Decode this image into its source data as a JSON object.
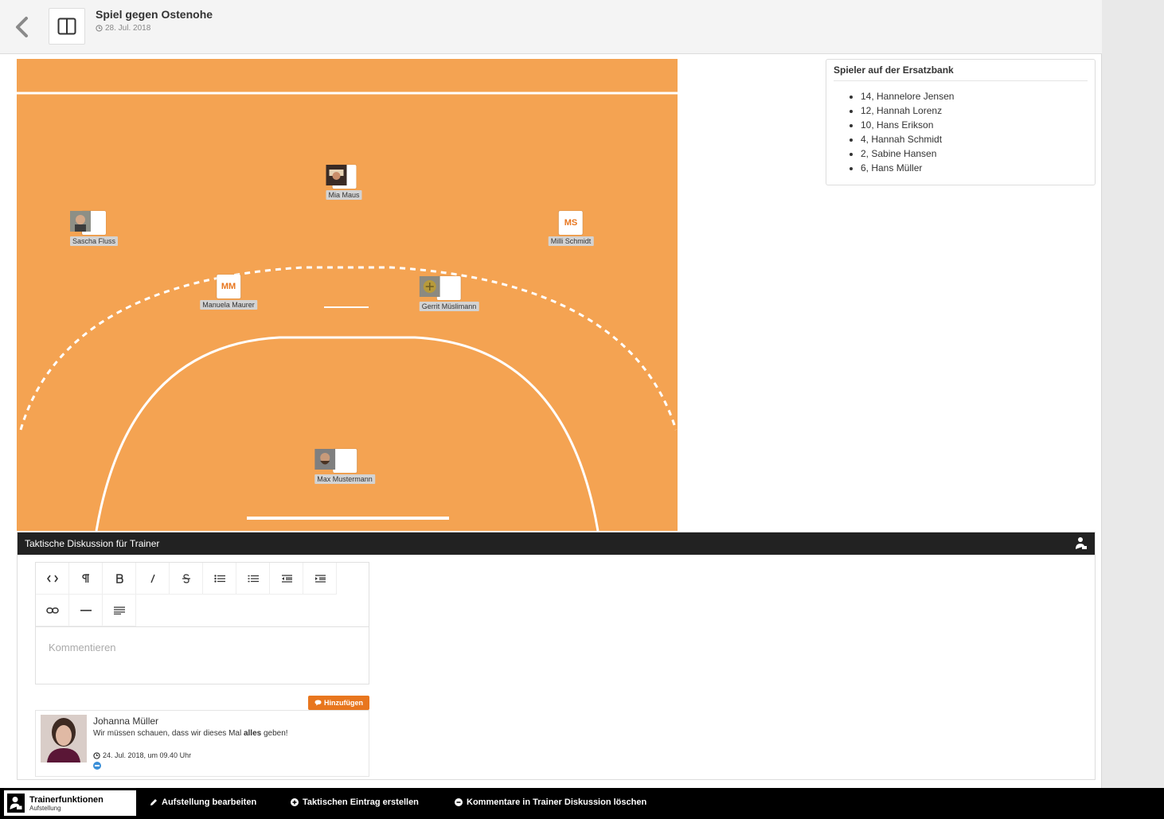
{
  "header": {
    "title": "Spiel gegen Ostenohe",
    "date": "28. Jul. 2018"
  },
  "field": {
    "color": "#f4a352",
    "players": [
      {
        "name": "Mia Maus",
        "initials": "",
        "photo": true
      },
      {
        "name": "Sascha Fluss",
        "initials": "",
        "photo": true
      },
      {
        "name": "Milli Schmidt",
        "initials": "MS",
        "photo": false
      },
      {
        "name": "Manuela Maurer",
        "initials": "MM",
        "photo": false
      },
      {
        "name": "Gerrit Müslimann",
        "initials": "",
        "photo": true
      },
      {
        "name": "Max Mustermann",
        "initials": "",
        "photo": true
      }
    ]
  },
  "bench": {
    "title": "Spieler auf der Ersatzbank",
    "players": [
      "14, Hannelore Jensen",
      "12, Hannah Lorenz",
      "10, Hans Erikson",
      "4, Hannah Schmidt",
      "2, Sabine Hansen",
      "6, Hans Müller"
    ]
  },
  "discussion": {
    "title": "Taktische Diskussion für Trainer",
    "placeholder": "Kommentieren",
    "add_label": "Hinzufügen",
    "comments": [
      {
        "author": "Johanna Müller",
        "text_before": "Wir müssen schauen, dass wir dieses Mal ",
        "text_bold": "alles",
        "text_after": " geben!",
        "time": "24. Jul. 2018, um 09.40 Uhr"
      }
    ]
  },
  "bottombar": {
    "tab_title": "Trainerfunktionen",
    "tab_subtitle": "Aufstellung",
    "actions": [
      "Aufstellung bearbeiten",
      "Taktischen Eintrag erstellen",
      "Kommentare in Trainer Diskussion löschen"
    ]
  },
  "colors": {
    "accent": "#e8761e",
    "court": "#f4a352",
    "bar": "#000000"
  }
}
